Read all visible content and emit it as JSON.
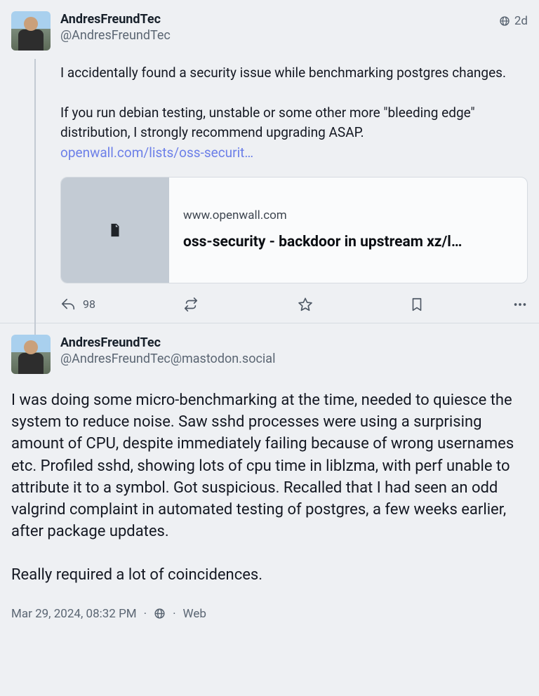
{
  "post1": {
    "displayname": "AndresFreundTec",
    "handle": "@AndresFreundTec",
    "visibility_icon": "globe-icon",
    "age": "2d",
    "body_p1": "I accidentally found a security issue while benchmarking postgres changes.",
    "body_p2": "If you run debian testing, unstable or some other more \"bleeding edge\" distribution, I strongly recommend upgrading ASAP.",
    "link_text": "openwall.com/lists/oss-securit…",
    "card": {
      "domain": "www.openwall.com",
      "title": "oss-security - backdoor in upstream xz/l…"
    },
    "reply_count": "98"
  },
  "post2": {
    "displayname": "AndresFreundTec",
    "handle": "@AndresFreundTec@mastodon.social",
    "body_p1": "I was doing some micro-benchmarking at the time, needed to quiesce the system to reduce noise. Saw sshd processes were using a surprising amount of CPU, despite immediately failing because of wrong usernames etc. Profiled sshd, showing lots of cpu time in liblzma, with perf unable to attribute it to a symbol. Got suspicious. Recalled that I had seen an odd valgrind complaint in automated testing of postgres, a few weeks earlier, after  package updates.",
    "body_p2": "Really required a lot of coincidences.",
    "timestamp": "Mar 29, 2024, 08:32 PM",
    "source": "Web"
  }
}
